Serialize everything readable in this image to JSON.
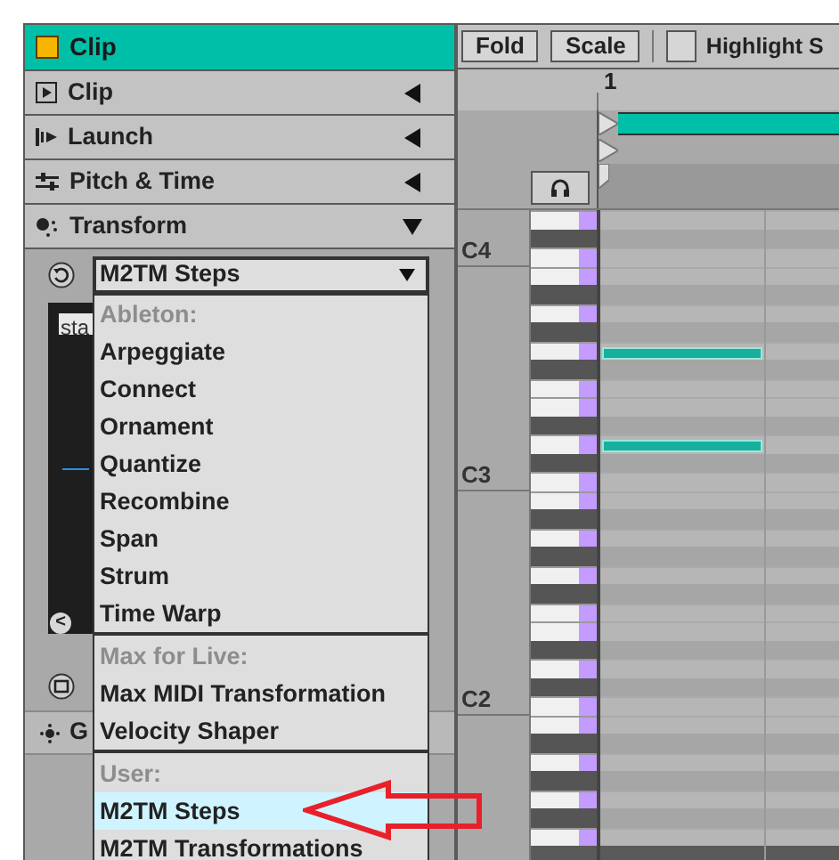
{
  "clip_header": {
    "title": "Clip"
  },
  "sections": [
    {
      "label": "Clip",
      "expanded": false
    },
    {
      "label": "Launch",
      "expanded": false
    },
    {
      "label": "Pitch & Time",
      "expanded": false
    },
    {
      "label": "Transform",
      "expanded": true
    }
  ],
  "transform": {
    "select": {
      "value": "M2TM Steps"
    },
    "field_text": "sta",
    "back_button": "<",
    "subsection": "G",
    "menu": {
      "groups": [
        {
          "header": "Ableton:",
          "items": [
            {
              "label": "Arpeggiate",
              "selected": false
            },
            {
              "label": "Connect",
              "selected": false
            },
            {
              "label": "Ornament",
              "selected": false
            },
            {
              "label": "Quantize",
              "selected": false
            },
            {
              "label": "Recombine",
              "selected": false
            },
            {
              "label": "Span",
              "selected": false
            },
            {
              "label": "Strum",
              "selected": false
            },
            {
              "label": "Time Warp",
              "selected": false
            }
          ]
        },
        {
          "header": "Max for Live:",
          "items": [
            {
              "label": "Max MIDI Transformation",
              "selected": false
            },
            {
              "label": "Velocity Shaper",
              "selected": false
            }
          ]
        },
        {
          "header": "User:",
          "items": [
            {
              "label": "M2TM Steps",
              "selected": true
            },
            {
              "label": "M2TM Transformations",
              "selected": false
            }
          ]
        }
      ]
    }
  },
  "toolbar": {
    "buttons": [
      "Fold",
      "Scale"
    ],
    "highlight": {
      "label": "Highlight S",
      "checked": false
    }
  },
  "ruler": {
    "bar": "1"
  },
  "rows": [
    {
      "kind": "white",
      "note": false
    },
    {
      "kind": "black",
      "note": false
    },
    {
      "kind": "white",
      "note": false,
      "label": "C4"
    },
    {
      "kind": "white",
      "note": false
    },
    {
      "kind": "black",
      "note": false
    },
    {
      "kind": "white",
      "note": false
    },
    {
      "kind": "black",
      "note": false
    },
    {
      "kind": "white",
      "note": true
    },
    {
      "kind": "black",
      "note": false
    },
    {
      "kind": "white",
      "note": false
    },
    {
      "kind": "white",
      "note": false
    },
    {
      "kind": "black",
      "note": false
    },
    {
      "kind": "white",
      "note": true
    },
    {
      "kind": "black",
      "note": false
    },
    {
      "kind": "white",
      "note": false,
      "label": "C3"
    },
    {
      "kind": "white",
      "note": false
    },
    {
      "kind": "black",
      "note": false
    },
    {
      "kind": "white",
      "note": false
    },
    {
      "kind": "black",
      "note": false
    },
    {
      "kind": "white",
      "note": false
    },
    {
      "kind": "black",
      "note": false
    },
    {
      "kind": "white",
      "note": false
    },
    {
      "kind": "white",
      "note": false
    },
    {
      "kind": "black",
      "note": false
    },
    {
      "kind": "white",
      "note": false
    },
    {
      "kind": "black",
      "note": false
    },
    {
      "kind": "white",
      "note": false,
      "label": "C2"
    },
    {
      "kind": "white",
      "note": false
    },
    {
      "kind": "black",
      "note": false
    },
    {
      "kind": "white",
      "note": false
    },
    {
      "kind": "black",
      "note": false
    },
    {
      "kind": "white",
      "note": false
    },
    {
      "kind": "black",
      "note": false
    },
    {
      "kind": "white",
      "note": false
    }
  ]
}
